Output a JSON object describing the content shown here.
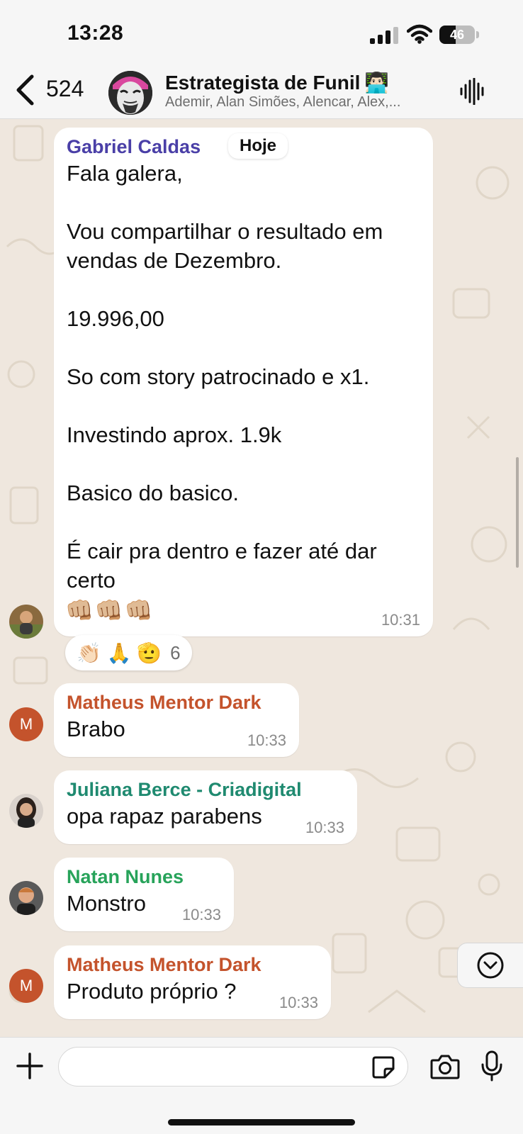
{
  "status_bar": {
    "time": "13:28",
    "battery_percent": "46",
    "battery_level": 0.46
  },
  "header": {
    "back_count": "524",
    "group_name": "Estrategista de Funil",
    "group_emoji": "👨🏻‍💻",
    "members": "Ademir, Alan Simões, Alencar, Alex,..."
  },
  "day_separator": "Hoje",
  "messages": [
    {
      "sender": "Gabriel Caldas",
      "sender_color": "#4a3fa7",
      "text": "Fala galera,\n\nVou compartilhar o resultado em vendas de Dezembro.\n\n19.996,00\n\nSo com story patrocinado e x1.\n\nInvestindo aprox. 1.9k\n\nBasico do basico.\n\nÉ cair pra dentro e fazer até dar certo",
      "emoji_line": "👊🏼👊🏼👊🏼",
      "time": "10:31",
      "reactions": {
        "emojis": "👏🏻 🙏 🫡",
        "count": "6"
      }
    },
    {
      "sender": "Matheus Mentor Dark",
      "sender_color": "#c4532c",
      "text": "Brabo",
      "time": "10:33",
      "avatar_letter": "M"
    },
    {
      "sender": "Juliana Berce - Criadigital",
      "sender_color": "#1f8a70",
      "text": "opa rapaz parabens",
      "time": "10:33"
    },
    {
      "sender": "Natan Nunes",
      "sender_color": "#27a35a",
      "text": "Monstro",
      "time": "10:33"
    },
    {
      "sender": "Matheus Mentor Dark",
      "sender_color": "#c4532c",
      "text": "Produto próprio ?",
      "time": "10:33",
      "avatar_letter": "M"
    }
  ],
  "icons": {
    "back": "chevron-left-icon",
    "voice": "audio-waveform-icon",
    "plus": "plus-icon",
    "sticker": "sticker-icon",
    "camera": "camera-icon",
    "mic": "microphone-icon",
    "jump": "chevron-down-circle-icon"
  },
  "composer": {
    "placeholder": ""
  }
}
